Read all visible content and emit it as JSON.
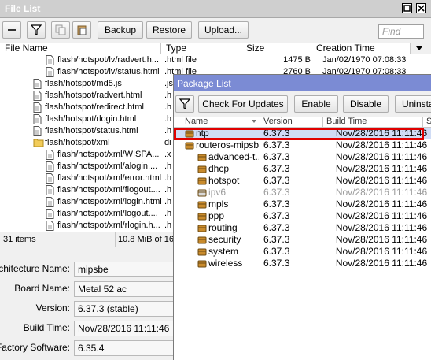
{
  "file_list": {
    "title": "File List",
    "toolbar": {
      "backup": "Backup",
      "restore": "Restore",
      "upload": "Upload...",
      "find_placeholder": "Find"
    },
    "columns": [
      "File Name",
      "Type",
      "Size",
      "Creation Time"
    ],
    "rows": [
      {
        "name": "flash/hotspot/lv/radvert.h...",
        "type": ".html file",
        "size": "1475 B",
        "created": "Jan/02/1970 07:08:33",
        "icon": "file-icon",
        "indent": 2
      },
      {
        "name": "flash/hotspot/lv/status.html",
        "type": ".html file",
        "size": "2760 B",
        "created": "Jan/02/1970 07:08:33",
        "icon": "file-icon",
        "indent": 2
      },
      {
        "name": "flash/hotspot/md5.js",
        "type": ".js",
        "size": "",
        "created": "",
        "icon": "file-icon",
        "indent": 1
      },
      {
        "name": "flash/hotspot/radvert.html",
        "type": ".h",
        "size": "",
        "created": "",
        "icon": "file-icon",
        "indent": 1
      },
      {
        "name": "flash/hotspot/redirect.html",
        "type": ".h",
        "size": "",
        "created": "",
        "icon": "file-icon",
        "indent": 1
      },
      {
        "name": "flash/hotspot/rlogin.html",
        "type": ".h",
        "size": "",
        "created": "",
        "icon": "file-icon",
        "indent": 1
      },
      {
        "name": "flash/hotspot/status.html",
        "type": ".h",
        "size": "",
        "created": "",
        "icon": "file-icon",
        "indent": 1
      },
      {
        "name": "flash/hotspot/xml",
        "type": "di",
        "size": "",
        "created": "",
        "icon": "folder-icon",
        "indent": 1
      },
      {
        "name": "flash/hotspot/xml/WISPA...",
        "type": ".x",
        "size": "",
        "created": "",
        "icon": "file-icon",
        "indent": 2
      },
      {
        "name": "flash/hotspot/xml/alogin....",
        "type": ".h",
        "size": "",
        "created": "",
        "icon": "file-icon",
        "indent": 2
      },
      {
        "name": "flash/hotspot/xml/error.html",
        "type": ".h",
        "size": "",
        "created": "",
        "icon": "file-icon",
        "indent": 2
      },
      {
        "name": "flash/hotspot/xml/flogout....",
        "type": ".h",
        "size": "",
        "created": "",
        "icon": "file-icon",
        "indent": 2
      },
      {
        "name": "flash/hotspot/xml/login.html",
        "type": ".h",
        "size": "",
        "created": "",
        "icon": "file-icon",
        "indent": 2
      },
      {
        "name": "flash/hotspot/xml/logout....",
        "type": ".h",
        "size": "",
        "created": "",
        "icon": "file-icon",
        "indent": 2
      },
      {
        "name": "flash/hotspot/xml/rlogin.h...",
        "type": ".h",
        "size": "",
        "created": "",
        "icon": "file-icon",
        "indent": 2
      }
    ],
    "status": {
      "count": "31 items",
      "usage": "10.8 MiB of 16"
    }
  },
  "info": {
    "fields": [
      {
        "label": "Architecture Name:",
        "value": "mipsbe"
      },
      {
        "label": "Board Name:",
        "value": "Metal 52 ac"
      },
      {
        "label": "Version:",
        "value": "6.37.3 (stable)"
      },
      {
        "label": "Build Time:",
        "value": "Nov/28/2016 11:11:46"
      },
      {
        "label": "Factory Software:",
        "value": "6.35.4"
      }
    ]
  },
  "package_list": {
    "title": "Package List",
    "toolbar": {
      "check": "Check For Updates",
      "enable": "Enable",
      "disable": "Disable",
      "uninstall": "Uninsta"
    },
    "columns": [
      "Name",
      "Version",
      "Build Time",
      "Sc"
    ],
    "rows": [
      {
        "name": "ntp",
        "version": "6.37.3",
        "build": "Nov/28/2016 11:11:46",
        "indent": 0,
        "selected": true,
        "disabled": false
      },
      {
        "name": "routeros-mipsbe",
        "version": "6.37.3",
        "build": "Nov/28/2016 11:11:46",
        "indent": 0,
        "selected": false,
        "disabled": false
      },
      {
        "name": "advanced-t...",
        "version": "6.37.3",
        "build": "Nov/28/2016 11:11:46",
        "indent": 1,
        "selected": false,
        "disabled": false
      },
      {
        "name": "dhcp",
        "version": "6.37.3",
        "build": "Nov/28/2016 11:11:46",
        "indent": 1,
        "selected": false,
        "disabled": false
      },
      {
        "name": "hotspot",
        "version": "6.37.3",
        "build": "Nov/28/2016 11:11:46",
        "indent": 1,
        "selected": false,
        "disabled": false
      },
      {
        "name": "ipv6",
        "version": "6.37.3",
        "build": "Nov/28/2016 11:11:46",
        "indent": 1,
        "selected": false,
        "disabled": true
      },
      {
        "name": "mpls",
        "version": "6.37.3",
        "build": "Nov/28/2016 11:11:46",
        "indent": 1,
        "selected": false,
        "disabled": false
      },
      {
        "name": "ppp",
        "version": "6.37.3",
        "build": "Nov/28/2016 11:11:46",
        "indent": 1,
        "selected": false,
        "disabled": false
      },
      {
        "name": "routing",
        "version": "6.37.3",
        "build": "Nov/28/2016 11:11:46",
        "indent": 1,
        "selected": false,
        "disabled": false
      },
      {
        "name": "security",
        "version": "6.37.3",
        "build": "Nov/28/2016 11:11:46",
        "indent": 1,
        "selected": false,
        "disabled": false
      },
      {
        "name": "system",
        "version": "6.37.3",
        "build": "Nov/28/2016 11:11:46",
        "indent": 1,
        "selected": false,
        "disabled": false
      },
      {
        "name": "wireless",
        "version": "6.37.3",
        "build": "Nov/28/2016 11:11:46",
        "indent": 1,
        "selected": false,
        "disabled": false
      }
    ]
  },
  "colors": {
    "package_title_bar": "#7b8bd4",
    "selection": "#d0dcf5",
    "highlight_border": "#e00000"
  }
}
